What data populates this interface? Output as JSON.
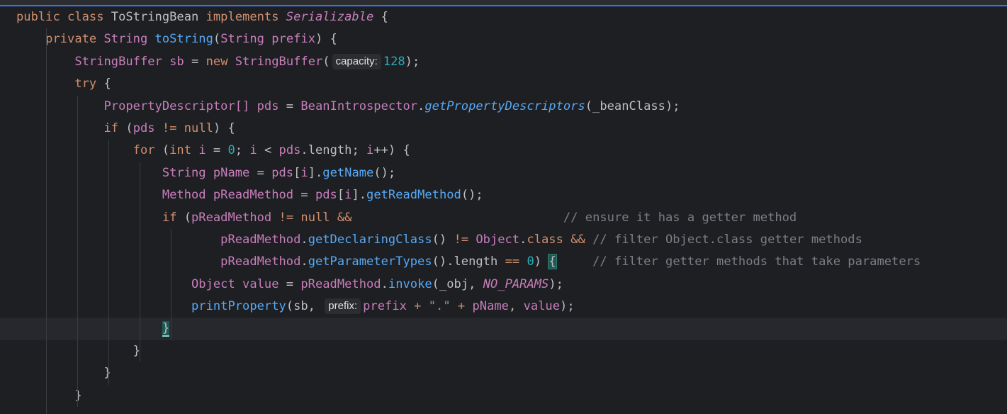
{
  "editor": {
    "lines": [
      [
        {
          "t": "public class ",
          "c": "k"
        },
        {
          "t": "ToStringBean",
          "c": ""
        },
        {
          "t": " implements ",
          "c": "k"
        },
        {
          "t": "Serializable",
          "c": "t it"
        },
        {
          "t": " {",
          "c": ""
        }
      ],
      [
        {
          "t": "    private ",
          "c": "k"
        },
        {
          "t": "String",
          "c": "t"
        },
        {
          "t": " ",
          "c": ""
        },
        {
          "t": "toString",
          "c": "f"
        },
        {
          "t": "(",
          "c": ""
        },
        {
          "t": "String",
          "c": "t"
        },
        {
          "t": " ",
          "c": ""
        },
        {
          "t": "prefix",
          "c": "p"
        },
        {
          "t": ") {",
          "c": ""
        }
      ],
      [
        {
          "t": "        ",
          "c": ""
        },
        {
          "t": "StringBuffer",
          "c": "t"
        },
        {
          "t": " ",
          "c": ""
        },
        {
          "t": "sb",
          "c": "fi"
        },
        {
          "t": " = ",
          "c": ""
        },
        {
          "t": "new ",
          "c": "k"
        },
        {
          "t": "StringBuffer",
          "c": "t"
        },
        {
          "t": "(",
          "c": ""
        },
        {
          "hint": "capacity:"
        },
        {
          "t": "128",
          "c": "n"
        },
        {
          "t": ");",
          "c": ""
        }
      ],
      [
        {
          "t": "        ",
          "c": ""
        },
        {
          "t": "try",
          "c": "k"
        },
        {
          "t": " {",
          "c": ""
        }
      ],
      [
        {
          "t": "            ",
          "c": ""
        },
        {
          "t": "PropertyDescriptor",
          "c": "t"
        },
        {
          "t": "[] ",
          "c": "t"
        },
        {
          "t": "pds",
          "c": "fi"
        },
        {
          "t": " = ",
          "c": ""
        },
        {
          "t": "BeanIntrospector",
          "c": "t"
        },
        {
          "t": ".",
          "c": ""
        },
        {
          "t": "getPropertyDescriptors",
          "c": "f it"
        },
        {
          "t": "(_beanClass);",
          "c": ""
        }
      ],
      [
        {
          "t": "            ",
          "c": ""
        },
        {
          "t": "if",
          "c": "k"
        },
        {
          "t": " (",
          "c": ""
        },
        {
          "t": "pds",
          "c": "fi"
        },
        {
          "t": " != ",
          "c": "k"
        },
        {
          "t": "null",
          "c": "k"
        },
        {
          "t": ") {",
          "c": ""
        }
      ],
      [
        {
          "t": "                ",
          "c": ""
        },
        {
          "t": "for",
          "c": "k"
        },
        {
          "t": " (",
          "c": ""
        },
        {
          "t": "int",
          "c": "k"
        },
        {
          "t": " ",
          "c": ""
        },
        {
          "t": "i",
          "c": "fi"
        },
        {
          "t": " = ",
          "c": ""
        },
        {
          "t": "0",
          "c": "n"
        },
        {
          "t": "; ",
          "c": ""
        },
        {
          "t": "i",
          "c": "fi"
        },
        {
          "t": " < ",
          "c": ""
        },
        {
          "t": "pds",
          "c": "fi"
        },
        {
          "t": ".length; ",
          "c": ""
        },
        {
          "t": "i",
          "c": "fi"
        },
        {
          "t": "++) {",
          "c": ""
        }
      ],
      [
        {
          "t": "                    ",
          "c": ""
        },
        {
          "t": "String",
          "c": "t"
        },
        {
          "t": " ",
          "c": ""
        },
        {
          "t": "pName",
          "c": "fi"
        },
        {
          "t": " = ",
          "c": ""
        },
        {
          "t": "pds",
          "c": "fi"
        },
        {
          "t": "[",
          "c": ""
        },
        {
          "t": "i",
          "c": "fi"
        },
        {
          "t": "].",
          "c": ""
        },
        {
          "t": "getName",
          "c": "f"
        },
        {
          "t": "();",
          "c": ""
        }
      ],
      [
        {
          "t": "                    ",
          "c": ""
        },
        {
          "t": "Method",
          "c": "t"
        },
        {
          "t": " ",
          "c": ""
        },
        {
          "t": "pReadMethod",
          "c": "fi"
        },
        {
          "t": " = ",
          "c": ""
        },
        {
          "t": "pds",
          "c": "fi"
        },
        {
          "t": "[",
          "c": ""
        },
        {
          "t": "i",
          "c": "fi"
        },
        {
          "t": "].",
          "c": ""
        },
        {
          "t": "getReadMethod",
          "c": "f"
        },
        {
          "t": "();",
          "c": ""
        }
      ],
      [
        {
          "t": "                    ",
          "c": ""
        },
        {
          "t": "if",
          "c": "k"
        },
        {
          "t": " (",
          "c": ""
        },
        {
          "t": "pReadMethod",
          "c": "fi"
        },
        {
          "t": " != ",
          "c": "k"
        },
        {
          "t": "null",
          "c": "k"
        },
        {
          "t": " &&",
          "c": "k"
        },
        {
          "t": "                             ",
          "c": ""
        },
        {
          "t": "// ensure it has a getter method",
          "c": "c"
        }
      ],
      [
        {
          "t": "                            ",
          "c": ""
        },
        {
          "t": "pReadMethod",
          "c": "fi"
        },
        {
          "t": ".",
          "c": ""
        },
        {
          "t": "getDeclaringClass",
          "c": "f"
        },
        {
          "t": "() ",
          "c": ""
        },
        {
          "t": "!= ",
          "c": "k"
        },
        {
          "t": "Object",
          "c": "t"
        },
        {
          "t": ".",
          "c": ""
        },
        {
          "t": "class",
          "c": "k"
        },
        {
          "t": " && ",
          "c": "k"
        },
        {
          "t": "// filter Object.class getter methods",
          "c": "c"
        }
      ],
      [
        {
          "t": "                            ",
          "c": ""
        },
        {
          "t": "pReadMethod",
          "c": "fi"
        },
        {
          "t": ".",
          "c": ""
        },
        {
          "t": "getParameterTypes",
          "c": "f"
        },
        {
          "t": "().length ",
          "c": ""
        },
        {
          "t": "==",
          "c": "k"
        },
        {
          "t": " ",
          "c": ""
        },
        {
          "t": "0",
          "c": "n"
        },
        {
          "t": ") ",
          "c": ""
        },
        {
          "t": "{",
          "c": "brace-match"
        },
        {
          "t": "     ",
          "c": ""
        },
        {
          "t": "// filter getter methods that take parameters",
          "c": "c"
        }
      ],
      [
        {
          "t": "                        ",
          "c": ""
        },
        {
          "t": "Object",
          "c": "t"
        },
        {
          "t": " ",
          "c": ""
        },
        {
          "t": "value",
          "c": "fi"
        },
        {
          "t": " = ",
          "c": ""
        },
        {
          "t": "pReadMethod",
          "c": "fi"
        },
        {
          "t": ".",
          "c": ""
        },
        {
          "t": "invoke",
          "c": "f"
        },
        {
          "t": "(_obj, ",
          "c": ""
        },
        {
          "t": "NO_PARAMS",
          "c": "fi it"
        },
        {
          "t": ");",
          "c": ""
        }
      ],
      [
        {
          "t": "                        ",
          "c": ""
        },
        {
          "t": "printProperty",
          "c": "f"
        },
        {
          "t": "(sb, ",
          "c": ""
        },
        {
          "hint": "prefix:"
        },
        {
          "t": "prefix",
          "c": "p"
        },
        {
          "t": " + ",
          "c": "k"
        },
        {
          "t": "\".\"",
          "c": "s"
        },
        {
          "t": " + ",
          "c": "k"
        },
        {
          "t": "pName",
          "c": "fi"
        },
        {
          "t": ", ",
          "c": ""
        },
        {
          "t": "value",
          "c": "fi"
        },
        {
          "t": ");",
          "c": ""
        }
      ],
      [
        {
          "t": "                    ",
          "c": ""
        },
        {
          "t": "}",
          "c": "caret-brace"
        }
      ],
      [
        {
          "t": "                }",
          "c": ""
        }
      ],
      [
        {
          "t": "            }",
          "c": ""
        }
      ],
      [
        {
          "t": "        }",
          "c": ""
        }
      ],
      [
        {
          "t": "        ",
          "c": ""
        }
      ]
    ],
    "current_line_index": 14
  }
}
